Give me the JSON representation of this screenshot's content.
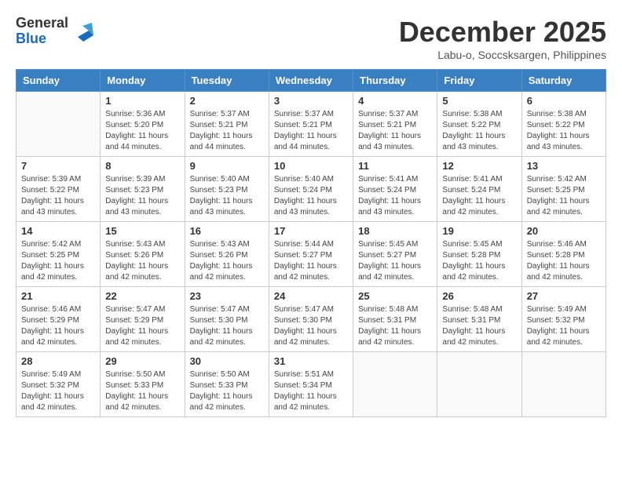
{
  "header": {
    "logo_line1": "General",
    "logo_line2": "Blue",
    "month_title": "December 2025",
    "location": "Labu-o, Soccsksargen, Philippines"
  },
  "days_of_week": [
    "Sunday",
    "Monday",
    "Tuesday",
    "Wednesday",
    "Thursday",
    "Friday",
    "Saturday"
  ],
  "weeks": [
    [
      {
        "day": "",
        "info": ""
      },
      {
        "day": "1",
        "info": "Sunrise: 5:36 AM\nSunset: 5:20 PM\nDaylight: 11 hours\nand 44 minutes."
      },
      {
        "day": "2",
        "info": "Sunrise: 5:37 AM\nSunset: 5:21 PM\nDaylight: 11 hours\nand 44 minutes."
      },
      {
        "day": "3",
        "info": "Sunrise: 5:37 AM\nSunset: 5:21 PM\nDaylight: 11 hours\nand 44 minutes."
      },
      {
        "day": "4",
        "info": "Sunrise: 5:37 AM\nSunset: 5:21 PM\nDaylight: 11 hours\nand 43 minutes."
      },
      {
        "day": "5",
        "info": "Sunrise: 5:38 AM\nSunset: 5:22 PM\nDaylight: 11 hours\nand 43 minutes."
      },
      {
        "day": "6",
        "info": "Sunrise: 5:38 AM\nSunset: 5:22 PM\nDaylight: 11 hours\nand 43 minutes."
      }
    ],
    [
      {
        "day": "7",
        "info": "Sunrise: 5:39 AM\nSunset: 5:22 PM\nDaylight: 11 hours\nand 43 minutes."
      },
      {
        "day": "8",
        "info": "Sunrise: 5:39 AM\nSunset: 5:23 PM\nDaylight: 11 hours\nand 43 minutes."
      },
      {
        "day": "9",
        "info": "Sunrise: 5:40 AM\nSunset: 5:23 PM\nDaylight: 11 hours\nand 43 minutes."
      },
      {
        "day": "10",
        "info": "Sunrise: 5:40 AM\nSunset: 5:24 PM\nDaylight: 11 hours\nand 43 minutes."
      },
      {
        "day": "11",
        "info": "Sunrise: 5:41 AM\nSunset: 5:24 PM\nDaylight: 11 hours\nand 43 minutes."
      },
      {
        "day": "12",
        "info": "Sunrise: 5:41 AM\nSunset: 5:24 PM\nDaylight: 11 hours\nand 42 minutes."
      },
      {
        "day": "13",
        "info": "Sunrise: 5:42 AM\nSunset: 5:25 PM\nDaylight: 11 hours\nand 42 minutes."
      }
    ],
    [
      {
        "day": "14",
        "info": "Sunrise: 5:42 AM\nSunset: 5:25 PM\nDaylight: 11 hours\nand 42 minutes."
      },
      {
        "day": "15",
        "info": "Sunrise: 5:43 AM\nSunset: 5:26 PM\nDaylight: 11 hours\nand 42 minutes."
      },
      {
        "day": "16",
        "info": "Sunrise: 5:43 AM\nSunset: 5:26 PM\nDaylight: 11 hours\nand 42 minutes."
      },
      {
        "day": "17",
        "info": "Sunrise: 5:44 AM\nSunset: 5:27 PM\nDaylight: 11 hours\nand 42 minutes."
      },
      {
        "day": "18",
        "info": "Sunrise: 5:45 AM\nSunset: 5:27 PM\nDaylight: 11 hours\nand 42 minutes."
      },
      {
        "day": "19",
        "info": "Sunrise: 5:45 AM\nSunset: 5:28 PM\nDaylight: 11 hours\nand 42 minutes."
      },
      {
        "day": "20",
        "info": "Sunrise: 5:46 AM\nSunset: 5:28 PM\nDaylight: 11 hours\nand 42 minutes."
      }
    ],
    [
      {
        "day": "21",
        "info": "Sunrise: 5:46 AM\nSunset: 5:29 PM\nDaylight: 11 hours\nand 42 minutes."
      },
      {
        "day": "22",
        "info": "Sunrise: 5:47 AM\nSunset: 5:29 PM\nDaylight: 11 hours\nand 42 minutes."
      },
      {
        "day": "23",
        "info": "Sunrise: 5:47 AM\nSunset: 5:30 PM\nDaylight: 11 hours\nand 42 minutes."
      },
      {
        "day": "24",
        "info": "Sunrise: 5:47 AM\nSunset: 5:30 PM\nDaylight: 11 hours\nand 42 minutes."
      },
      {
        "day": "25",
        "info": "Sunrise: 5:48 AM\nSunset: 5:31 PM\nDaylight: 11 hours\nand 42 minutes."
      },
      {
        "day": "26",
        "info": "Sunrise: 5:48 AM\nSunset: 5:31 PM\nDaylight: 11 hours\nand 42 minutes."
      },
      {
        "day": "27",
        "info": "Sunrise: 5:49 AM\nSunset: 5:32 PM\nDaylight: 11 hours\nand 42 minutes."
      }
    ],
    [
      {
        "day": "28",
        "info": "Sunrise: 5:49 AM\nSunset: 5:32 PM\nDaylight: 11 hours\nand 42 minutes."
      },
      {
        "day": "29",
        "info": "Sunrise: 5:50 AM\nSunset: 5:33 PM\nDaylight: 11 hours\nand 42 minutes."
      },
      {
        "day": "30",
        "info": "Sunrise: 5:50 AM\nSunset: 5:33 PM\nDaylight: 11 hours\nand 42 minutes."
      },
      {
        "day": "31",
        "info": "Sunrise: 5:51 AM\nSunset: 5:34 PM\nDaylight: 11 hours\nand 42 minutes."
      },
      {
        "day": "",
        "info": ""
      },
      {
        "day": "",
        "info": ""
      },
      {
        "day": "",
        "info": ""
      }
    ]
  ]
}
